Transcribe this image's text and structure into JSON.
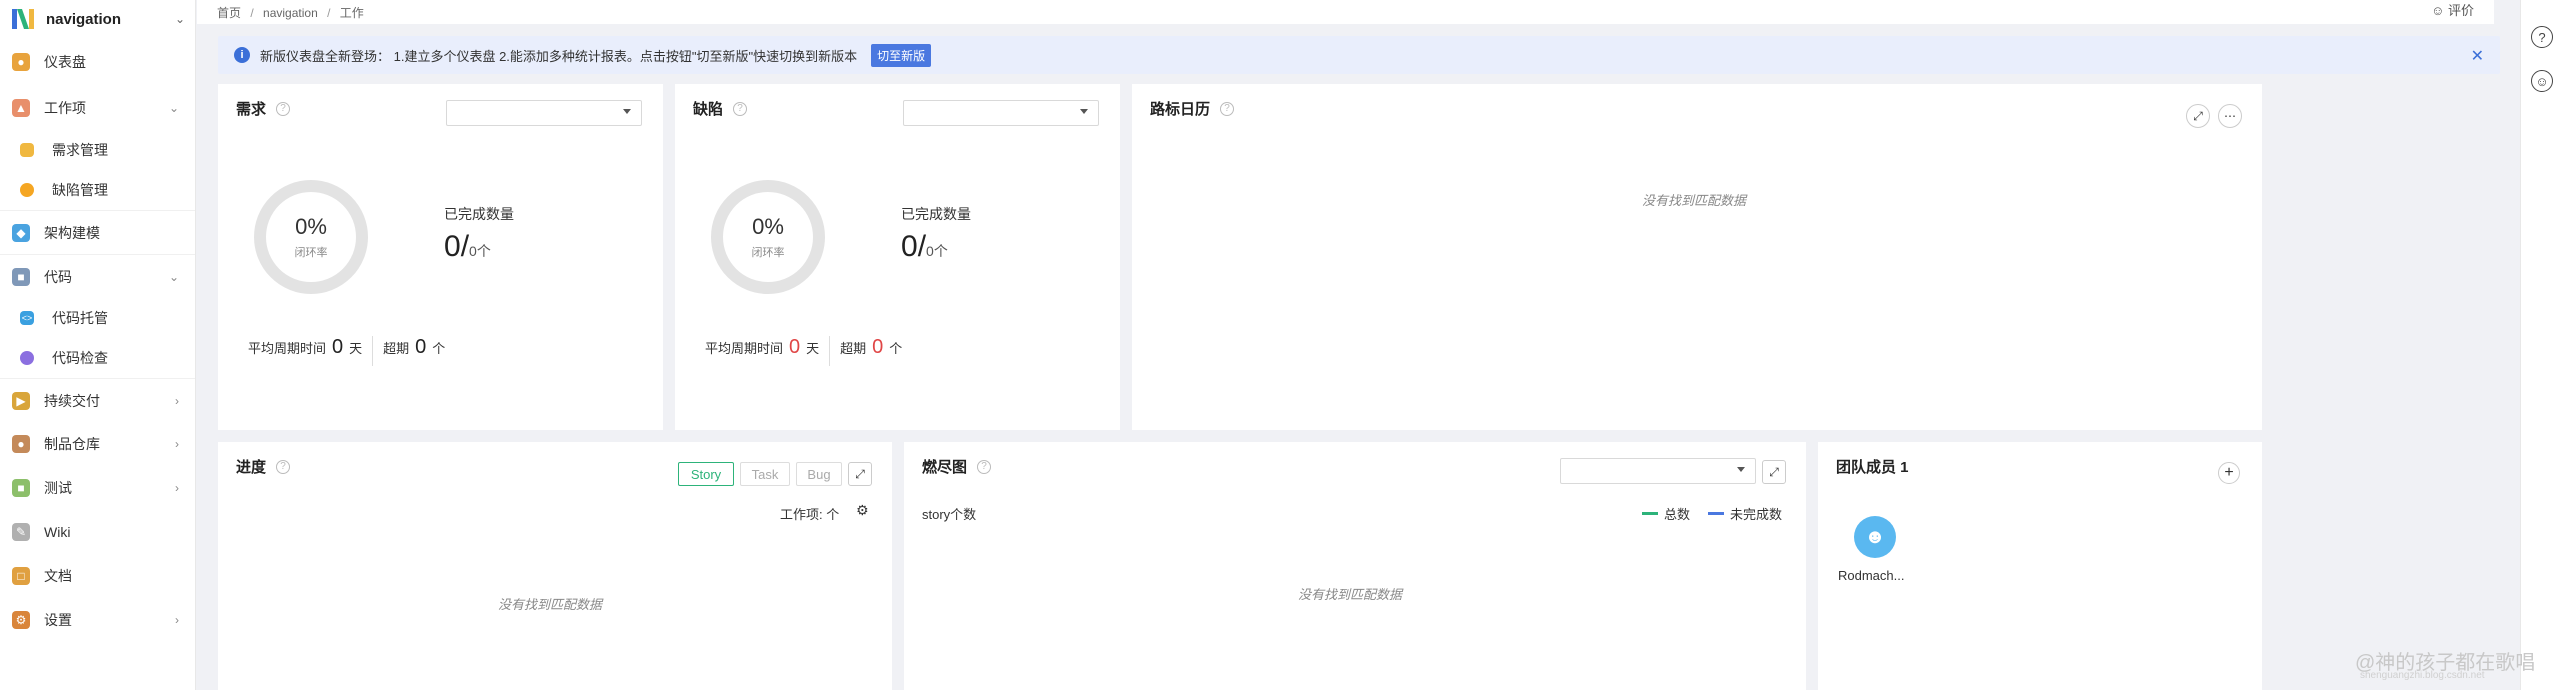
{
  "brand": {
    "name": "navigation"
  },
  "sidebar": {
    "items": [
      {
        "label": "仪表盘",
        "icon": "dashboard-icon",
        "color": "#e8a33d"
      },
      {
        "label": "工作项",
        "icon": "workitem-icon",
        "color": "#e88f6b"
      },
      {
        "label": "需求管理",
        "icon": "requirement-icon",
        "color": "#f0b840"
      },
      {
        "label": "缺陷管理",
        "icon": "bug-icon",
        "color": "#f5a623"
      },
      {
        "label": "架构建模",
        "icon": "architecture-icon",
        "color": "#4aa3e0"
      },
      {
        "label": "代码",
        "icon": "code-icon",
        "color": "#7f98b8"
      },
      {
        "label": "代码托管",
        "icon": "code-hosting-icon",
        "color": "#3aa0e0"
      },
      {
        "label": "代码检查",
        "icon": "code-check-icon",
        "color": "#8b6fe0"
      },
      {
        "label": "持续交付",
        "icon": "delivery-icon",
        "color": "#d9a53a"
      },
      {
        "label": "制品仓库",
        "icon": "artifact-icon",
        "color": "#c48a5a"
      },
      {
        "label": "测试",
        "icon": "test-icon",
        "color": "#8cbf6a"
      },
      {
        "label": "Wiki",
        "icon": "wiki-icon",
        "color": "#b0b0b0"
      },
      {
        "label": "文档",
        "icon": "docs-icon",
        "color": "#e0a040"
      },
      {
        "label": "设置",
        "icon": "settings-icon",
        "color": "#d9853a"
      }
    ]
  },
  "breadcrumb": [
    "首页",
    "navigation",
    "工作"
  ],
  "topbar": {
    "right_text": "评价"
  },
  "banner": {
    "text": "新版仪表盘全新登场： 1.建立多个仪表盘 2.能添加多种统计报表。点击按钮\"切至新版\"快速切换到新版本",
    "button": "切至新版"
  },
  "requirement_card": {
    "title": "需求",
    "ring_pct": "0%",
    "ring_label": "闭环率",
    "done_label": "已完成数量",
    "done_value": "0",
    "done_slash": "/",
    "done_total": "0个",
    "avg_label": "平均周期时间",
    "avg_value": "0",
    "avg_unit": "天",
    "overdue_label": "超期",
    "overdue_value": "0",
    "overdue_unit": "个"
  },
  "defect_card": {
    "title": "缺陷",
    "ring_pct": "0%",
    "ring_label": "闭环率",
    "done_label": "已完成数量",
    "done_value": "0",
    "done_slash": "/",
    "done_total": "0个",
    "avg_label": "平均周期时间",
    "avg_value": "0",
    "avg_unit": "天",
    "overdue_label": "超期",
    "overdue_value": "0",
    "overdue_unit": "个"
  },
  "roadmap_card": {
    "title": "路标日历",
    "empty": "没有找到匹配数据"
  },
  "progress_card": {
    "title": "进度",
    "tabs": [
      "Story",
      "Task",
      "Bug"
    ],
    "workitem_label": "工作项: 个",
    "empty": "没有找到匹配数据"
  },
  "burndown_card": {
    "title": "燃尽图",
    "y_label": "story个数",
    "legend": [
      {
        "name": "总数",
        "color": "#2db37a"
      },
      {
        "name": "未完成数",
        "color": "#4a78e0"
      }
    ],
    "empty": "没有找到匹配数据"
  },
  "team_card": {
    "title": "团队成员 1",
    "member_name": "Rodmach..."
  },
  "watermark": {
    "text": "@神的孩子都在歌唱",
    "sub": "shenguangzhi.blog.csdn.net"
  },
  "colors": {
    "accent": "#4a78e0",
    "green": "#2db37a",
    "red": "#e04646"
  }
}
